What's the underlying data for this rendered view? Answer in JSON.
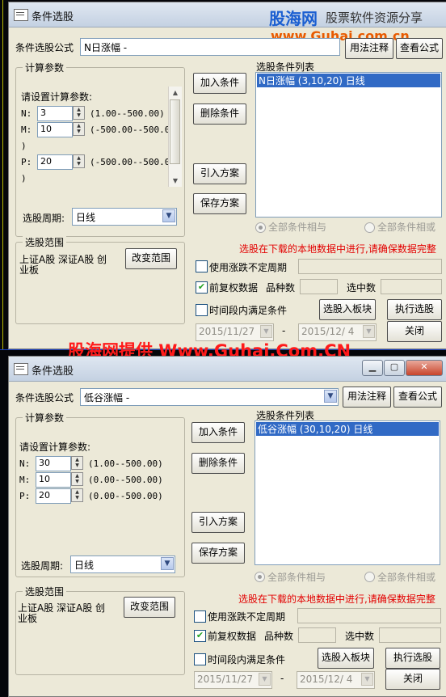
{
  "watermark": {
    "logo_cn": "股海网",
    "slogan": "股票软件资源分享",
    "url": "www.Guhai.com.cn",
    "banner": "股海网提供 Www.Guhai.Com.CN"
  },
  "colors": {
    "accent_red": "#e30000",
    "selection_blue": "#316ac5",
    "window_face": "#ece9d8"
  },
  "windows": [
    {
      "title": "条件选股",
      "formula_label": "条件选股公式",
      "formula_value": "N日涨幅          -",
      "usage_button": "用法注释",
      "view_button": "查看公式",
      "params_group": "计算参数",
      "params_prompt": "请设置计算参数:",
      "params": [
        {
          "name": "N:",
          "value": "3",
          "range": "(1.00--500.00)",
          "range_wrap": ""
        },
        {
          "name": "M:",
          "value": "10",
          "range": "(-500.00--500.00",
          "range_wrap": ")"
        },
        {
          "name": "P:",
          "value": "20",
          "range": "(-500.00--500.00",
          "range_wrap": ")"
        }
      ],
      "period_label": "选股周期:",
      "period_value": "日线",
      "list_label": "选股条件列表",
      "list_items": [
        "N日涨幅 (3,10,20) 日线"
      ],
      "add_condition": "加入条件",
      "delete_condition": "删除条件",
      "import_plan": "引入方案",
      "save_plan": "保存方案",
      "radio_and": "全部条件相与",
      "radio_or": "全部条件相或",
      "warning": "选股在下载的本地数据中进行,请确保数据完整",
      "range_group": "选股范围",
      "range_text_1": "上证A股 深证A股 创",
      "range_text_2": "业板",
      "change_range": "改变范围",
      "chk_uncertain": "使用涨跌不定周期",
      "chk_adjust": "前复权数据",
      "variety_label": "品种数",
      "selected_label": "选中数",
      "chk_period": "时间段内满足条件",
      "to_block": "选股入板块",
      "run_select": "执行选股",
      "date_from": "2015/11/27",
      "date_dash": "-",
      "date_to": "2015/12/ 4",
      "close": "关闭"
    },
    {
      "title": "条件选股",
      "formula_label": "条件选股公式",
      "formula_value": "低谷涨幅          -",
      "usage_button": "用法注释",
      "view_button": "查看公式",
      "params_group": "计算参数",
      "params_prompt": "请设置计算参数:",
      "params": [
        {
          "name": "N:",
          "value": "30",
          "range": "(1.00--500.00)",
          "range_wrap": ""
        },
        {
          "name": "M:",
          "value": "10",
          "range": "(0.00--500.00)",
          "range_wrap": ""
        },
        {
          "name": "P:",
          "value": "20",
          "range": "(0.00--500.00)",
          "range_wrap": ""
        }
      ],
      "period_label": "选股周期:",
      "period_value": "日线",
      "list_label": "选股条件列表",
      "list_items": [
        "低谷涨幅 (30,10,20) 日线"
      ],
      "add_condition": "加入条件",
      "delete_condition": "删除条件",
      "import_plan": "引入方案",
      "save_plan": "保存方案",
      "radio_and": "全部条件相与",
      "radio_or": "全部条件相或",
      "warning": "选股在下载的本地数据中进行,请确保数据完整",
      "range_group": "选股范围",
      "range_text_1": "上证A股 深证A股 创",
      "range_text_2": "业板",
      "change_range": "改变范围",
      "chk_uncertain": "使用涨跌不定周期",
      "chk_adjust": "前复权数据",
      "variety_label": "品种数",
      "selected_label": "选中数",
      "chk_period": "时间段内满足条件",
      "to_block": "选股入板块",
      "run_select": "执行选股",
      "date_from": "2015/11/27",
      "date_dash": "-",
      "date_to": "2015/12/ 4",
      "close": "关闭"
    }
  ]
}
